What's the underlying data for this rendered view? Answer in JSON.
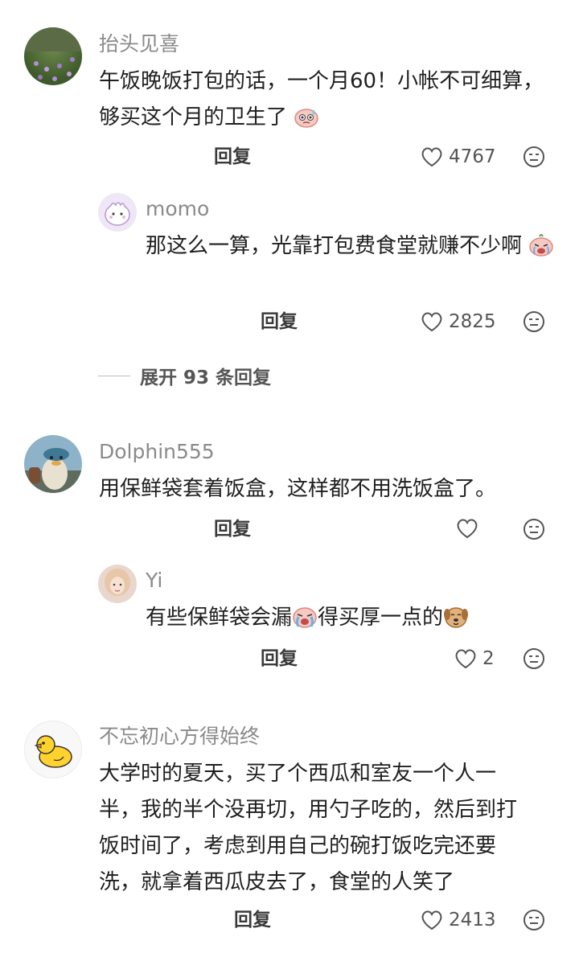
{
  "comments": [
    {
      "username": "抬头见喜",
      "text": "午饭晚饭打包的话，一个月60！小帐不可细算，够买这个月的卫生了",
      "reply_label": "回复",
      "likes": "4767",
      "emoji_icon": "sweat-emoji-icon",
      "replies": [
        {
          "username": "momo",
          "text": "那这么一算，光靠打包费食堂就赚不少啊",
          "reply_label": "回复",
          "likes": "2825",
          "emoji_icon": "crying-emoji-icon"
        }
      ],
      "expand_label": "展开 93 条回复"
    },
    {
      "username": "Dolphin555",
      "text": "用保鲜袋套着饭盒，这样都不用洗饭盒了。",
      "reply_label": "回复",
      "likes": "",
      "replies": [
        {
          "username": "Yi",
          "text_before": "有些保鲜袋会漏",
          "text_after": "得买厚一点的",
          "reply_label": "回复",
          "likes": "2",
          "emoji_icons": [
            "crying-emoji-icon",
            "dog-emoji-icon"
          ]
        }
      ]
    },
    {
      "username": "不忘初心方得始终",
      "text": "大学时的夏天，买了个西瓜和室友一个人一半，我的半个没再切，用勺子吃的，然后到打饭时间了，考虑到用自己的碗打饭吃完还要洗，就拿着西瓜皮去了，食堂的人笑了",
      "reply_label": "回复",
      "likes": "2413"
    }
  ],
  "icons": {
    "heart": "heart-icon",
    "dislike": "dislike-face-icon"
  },
  "colors": {
    "username": "#8a8a8a",
    "text": "#1f1f1f",
    "meta": "#555555"
  }
}
